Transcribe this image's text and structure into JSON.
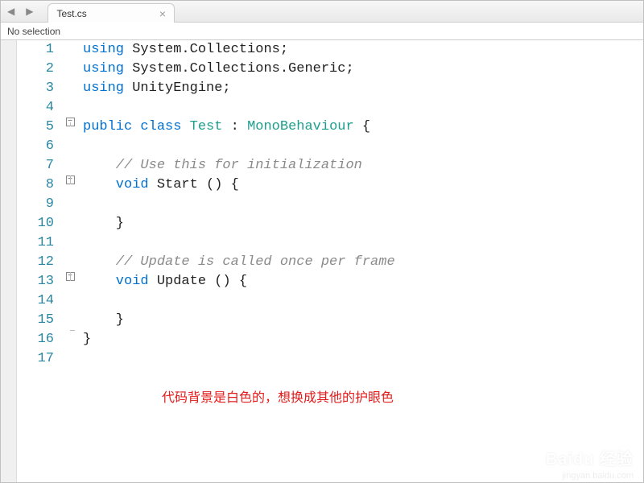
{
  "tabs": {
    "back": "◀",
    "fwd": "▶",
    "file": "Test.cs",
    "close": "×"
  },
  "crumb": "No selection",
  "code": {
    "l1": {
      "n": "1",
      "kw1": "using",
      "t1": " System.Collections;"
    },
    "l2": {
      "n": "2",
      "kw1": "using",
      "t1": " System.Collections.Generic;"
    },
    "l3": {
      "n": "3",
      "kw1": "using",
      "t1": " UnityEngine;"
    },
    "l4": {
      "n": "4"
    },
    "l5": {
      "n": "5",
      "kw1": "public",
      "kw2": " class",
      "typ1": " Test",
      "t1": " : ",
      "typ2": "MonoBehaviour",
      "t2": " {"
    },
    "l6": {
      "n": "6"
    },
    "l7": {
      "n": "7",
      "cm": "    // Use this for initialization"
    },
    "l8": {
      "n": "8",
      "kw1": "    void",
      "t1": " Start () {"
    },
    "l9": {
      "n": "9"
    },
    "l10": {
      "n": "10",
      "t1": "    }"
    },
    "l11": {
      "n": "11"
    },
    "l12": {
      "n": "12",
      "cm": "    // Update is called once per frame"
    },
    "l13": {
      "n": "13",
      "kw1": "    void",
      "t1": " Update () {"
    },
    "l14": {
      "n": "14"
    },
    "l15": {
      "n": "15",
      "t1": "    }"
    },
    "l16": {
      "n": "16",
      "t1": "}"
    },
    "l17": {
      "n": "17"
    }
  },
  "fold_glyph": "−",
  "annotation": "代码背景是白色的，想换成其他的护眼色",
  "wm": {
    "brand": "Baidu 经验",
    "sub": "jingyan.baidu.com"
  }
}
